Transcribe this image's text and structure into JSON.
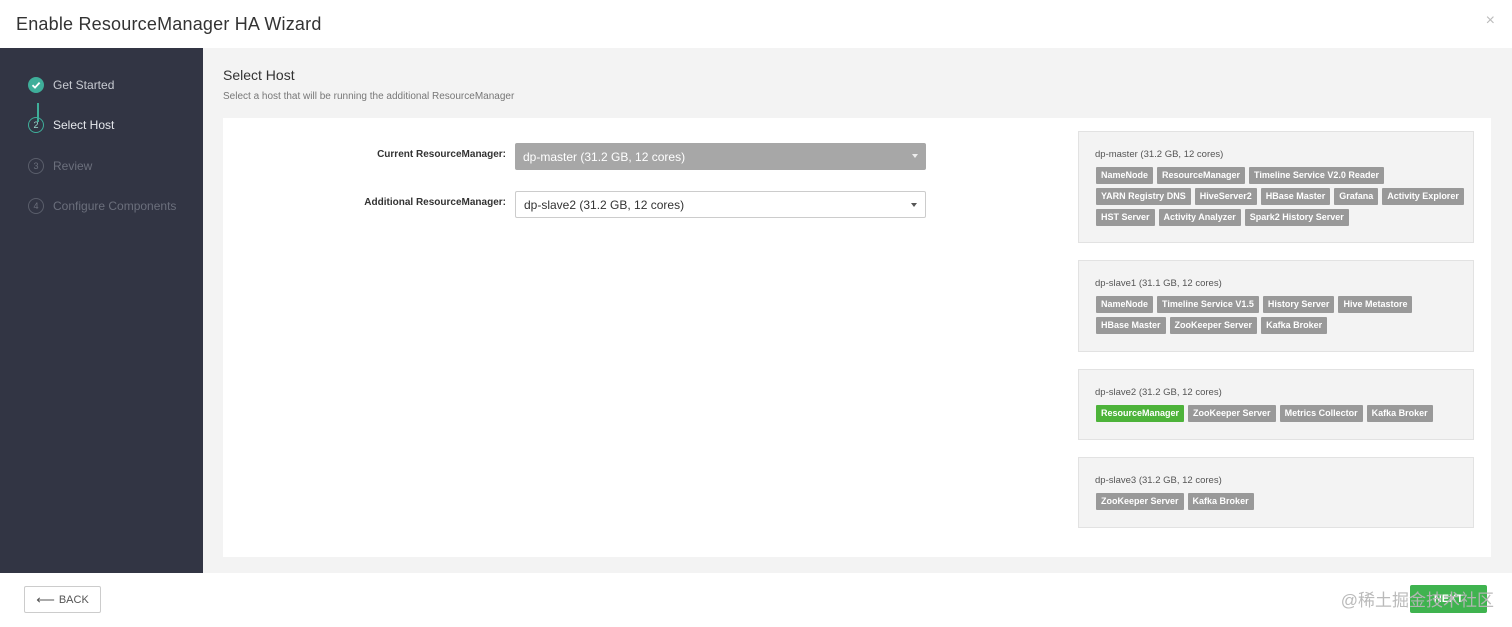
{
  "modal": {
    "title": "Enable ResourceManager HA Wizard",
    "close_glyph": "×"
  },
  "sidebar": {
    "steps": [
      {
        "number": "✓",
        "label": "Get Started"
      },
      {
        "number": "2",
        "label": "Select Host"
      },
      {
        "number": "3",
        "label": "Review"
      },
      {
        "number": "4",
        "label": "Configure Components"
      }
    ]
  },
  "content": {
    "title": "Select Host",
    "subtitle": "Select a host that will be running the additional ResourceManager"
  },
  "form": {
    "current_label": "Current ResourceManager:",
    "current_value": "dp-master (31.2 GB, 12 cores)",
    "additional_label": "Additional ResourceManager:",
    "additional_value": "dp-slave2 (31.2 GB, 12 cores)"
  },
  "hosts": [
    {
      "name": "dp-master (31.2 GB, 12 cores)",
      "components": [
        "NameNode",
        "ResourceManager",
        "Timeline Service V2.0 Reader",
        "YARN Registry DNS",
        "HiveServer2",
        "HBase Master",
        "Grafana",
        "Activity Explorer",
        "HST Server",
        "Activity Analyzer",
        "Spark2 History Server"
      ]
    },
    {
      "name": "dp-slave1 (31.1 GB, 12 cores)",
      "components": [
        "NameNode",
        "Timeline Service V1.5",
        "History Server",
        "Hive Metastore",
        "HBase Master",
        "ZooKeeper Server",
        "Kafka Broker"
      ]
    },
    {
      "name": "dp-slave2 (31.2 GB, 12 cores)",
      "components": [
        "ResourceManager",
        "ZooKeeper Server",
        "Metrics Collector",
        "Kafka Broker"
      ]
    },
    {
      "name": "dp-slave3 (31.2 GB, 12 cores)",
      "components": [
        "ZooKeeper Server",
        "Kafka Broker"
      ]
    }
  ],
  "footer": {
    "back_arrow": "⟵",
    "back_label": "BACK",
    "next_label": "NEXT",
    "watermark": "@稀土掘金技术社区"
  },
  "colors": {
    "accent": "#3fae9a",
    "next": "#3fb34f",
    "tag": "#999999",
    "tag_new": "#4db33a"
  }
}
